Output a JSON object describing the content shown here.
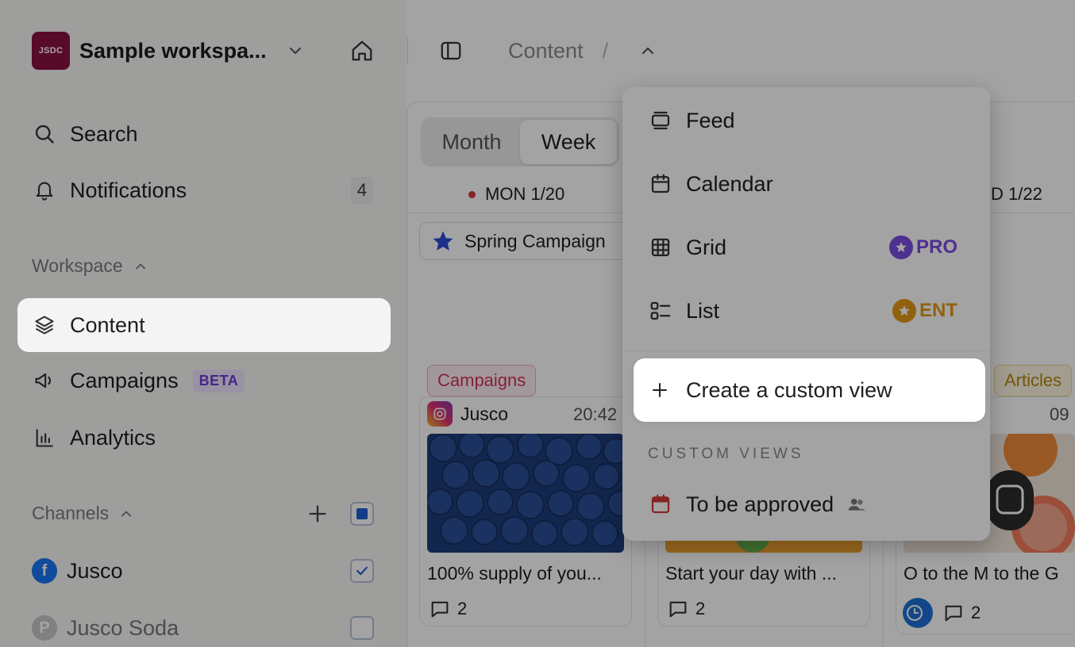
{
  "workspace": {
    "logo_text": "JSDC",
    "name": "Sample workspa...",
    "logo_color": "#8a1240"
  },
  "breadcrumb": {
    "current": "Content",
    "separator": "/"
  },
  "nav": {
    "search": "Search",
    "notifications": "Notifications",
    "notifications_count": "4",
    "workspace_section": "Workspace",
    "content": "Content",
    "campaigns": "Campaigns",
    "campaigns_badge": "BETA",
    "analytics": "Analytics",
    "channels_section": "Channels"
  },
  "channels": [
    {
      "name": "Jusco",
      "network": "facebook",
      "checked": true
    },
    {
      "name": "Jusco Soda",
      "network": "pinterest",
      "checked": false
    }
  ],
  "calendar": {
    "view_toggle": [
      "Month",
      "Week"
    ],
    "active_view": "Week",
    "days": [
      "MON 1/20",
      "D 1/22"
    ],
    "campaign_chip": "Spring Campaign",
    "posts": [
      {
        "tag": "Campaigns",
        "account": "Jusco",
        "time": "20:42",
        "text": "100% supply of you...",
        "comments": "2"
      },
      {
        "text": "Start your day with ...",
        "comments": "2"
      },
      {
        "tag": "Articles",
        "time": "09",
        "text": "O to the M to the G",
        "comments": "2"
      }
    ]
  },
  "dropdown": {
    "items": [
      {
        "label": "Feed",
        "icon": "feed-icon"
      },
      {
        "label": "Calendar",
        "icon": "calendar-icon"
      },
      {
        "label": "Grid",
        "icon": "grid-icon",
        "tier": "PRO"
      },
      {
        "label": "List",
        "icon": "list-icon",
        "tier": "ENT"
      }
    ],
    "create_label": "Create a custom view",
    "custom_views_title": "CUSTOM VIEWS",
    "custom_views": [
      {
        "label": "To be approved",
        "shared": true
      }
    ]
  },
  "colors": {
    "accent_blue": "#1f5fd6",
    "pro": "#7b4be0",
    "ent": "#e39a17",
    "campaign_tag": "#d2335c"
  }
}
